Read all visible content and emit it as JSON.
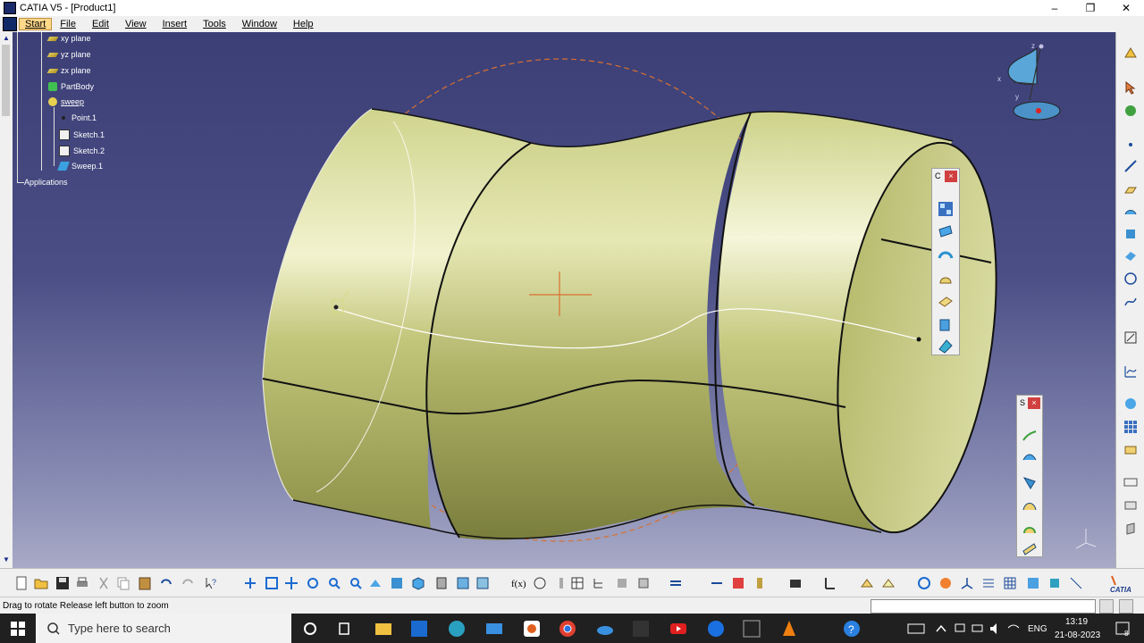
{
  "window": {
    "title": "CATIA V5 - [Product1]",
    "minimize": "–",
    "restore": "❐",
    "close": "✕"
  },
  "menu": {
    "items": [
      "Start",
      "File",
      "Edit",
      "View",
      "Insert",
      "Tools",
      "Window",
      "Help"
    ]
  },
  "tree": {
    "xy_plane": "xy plane",
    "yz_plane": "yz plane",
    "zx_plane": "zx plane",
    "partbody": "PartBody",
    "sweep": "sweep",
    "point1": "Point.1",
    "sketch1": "Sketch.1",
    "sketch2": "Sketch.2",
    "sweep1": "Sweep.1",
    "applications": "Applications"
  },
  "compass": {
    "z": "z",
    "x": "x",
    "y": "y"
  },
  "float_toolbars": {
    "c_title": "C",
    "s_title": "S",
    "close": "×"
  },
  "statusbar": {
    "text": "Drag to rotate  Release left button to zoom"
  },
  "taskbar": {
    "search_placeholder": "Search",
    "search_text": "Type here to search",
    "lang": "ENG",
    "time": "13:19",
    "date": "21-08-2023",
    "notif_count": "8"
  },
  "branding": {
    "catia": "CATIA"
  },
  "colors": {
    "viewport_top": "#3c3f76",
    "surface": "#d4d69a",
    "accent_orange": "#d87030"
  }
}
